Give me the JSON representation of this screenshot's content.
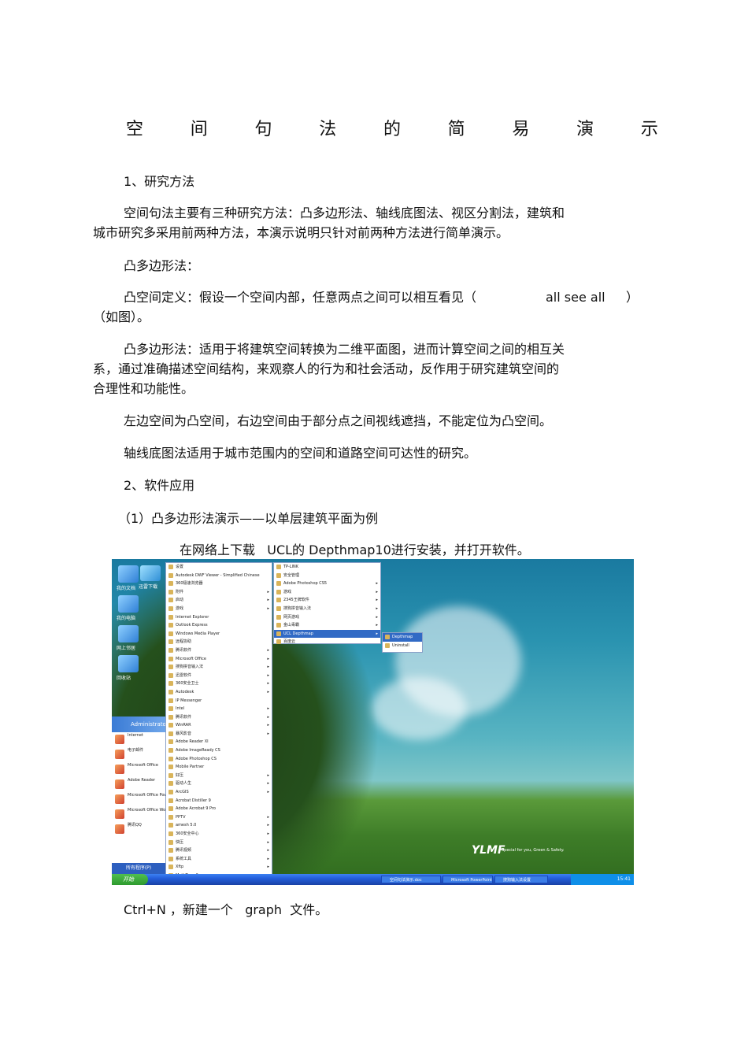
{
  "title_chars": [
    "空",
    "间",
    "句",
    "法",
    "的",
    "简",
    "易",
    "演",
    "示"
  ],
  "section1_heading": "1、研究方法",
  "para_intro_1": "空间句法主要有三种研究方法：凸多边形法、轴线底图法、视区分割法，建筑和",
  "para_intro_2": "城市研究多采用前两种方法，本演示说明只针对前两种方法进行简单演示。",
  "convex_heading": "凸多边形法：",
  "convex_def_a": "凸空间定义：假设一个空间内部，任意两点之间可以相互看见（",
  "convex_def_b": "all see all",
  "convex_def_c": "）",
  "convex_def_2": "（如图）。",
  "convex_method_1": "凸多边形法：适用于将建筑空间转换为二维平面图，进而计算空间之间的相互关",
  "convex_method_2": "系，通过准确描述空间结构，来观察人的行为和社会活动，反作用于研究建筑空间的",
  "convex_method_3": "合理性和功能性。",
  "left_right_para": "左边空间为凸空间，右边空间由于部分点之间视线遮挡，不能定位为凸空间。",
  "axial_para": "轴线底图法适用于城市范围内的空间和道路空间可达性的研究。",
  "section2_heading": "2、软件应用",
  "subsection_1": "（1）凸多边形法演示——以单层建筑平面为例",
  "download_para": "在网络上下载   UCL的 Depthmap10进行安装，并打开软件。",
  "ctrl_n_para": "Ctrl+N ，新建一个   graph  文件。",
  "screenshot": {
    "desktop_icons": [
      "我的文档",
      "迅雷下载",
      "我的电脑",
      "网上邻居",
      "回收站"
    ],
    "start_user": "Administrator",
    "start_items": [
      "Internet",
      "电子邮件",
      "Microsoft Office",
      "Adobe Reader",
      "Microsoft Office PowerPoint 2007",
      "Microsoft Office Word 2007",
      "腾讯QQ"
    ],
    "all_programs": "所有程序(P)",
    "menu1_items": [
      "设置",
      "Autodesk DWF Viewer - Simplified Chinese",
      "360极速浏览器",
      "附件",
      "启动",
      "游戏",
      "Internet Explorer",
      "Outlook Express",
      "Windows Media Player",
      "远程协助",
      "腾讯软件",
      "Microsoft Office",
      "搜狗拼音输入法",
      "迅雷软件",
      "360安全卫士",
      "Autodesk",
      "IP Messenger",
      "Intel",
      "腾讯软件",
      "WinRAR",
      "暴风影音",
      "Adobe Reader XI",
      "Adobe ImageReady CS",
      "Adobe Photoshop CS",
      "Mobile Partner",
      "好压",
      "驱动人生",
      "ArcGIS",
      "Acrobat Distiller 9",
      "Adobe Acrobat 9 Pro",
      "PPTV",
      "amesh 5.0",
      "360安全中心",
      "快压",
      "腾讯视频",
      "系统工具",
      "Xftp",
      "MathType 6"
    ],
    "menu2_items": [
      "TP-LINK",
      "安全管理",
      "Adobe Photoshop CS5",
      "游戏",
      "2345王牌软件",
      "搜狗拼音输入法",
      "网页游戏",
      "金山毒霸",
      "UCL Depthmap",
      "百度云"
    ],
    "menu3_items": [
      "Depthmap",
      "Uninstall"
    ],
    "start_button": "开始",
    "task_items": [
      "空间句法演示.doc",
      "Microsoft PowerPoint",
      "搜狗输入法设置"
    ],
    "tray_time": "15:41",
    "logo": "YLMF",
    "logo_tagline": "Special for you, Green & Safety."
  }
}
